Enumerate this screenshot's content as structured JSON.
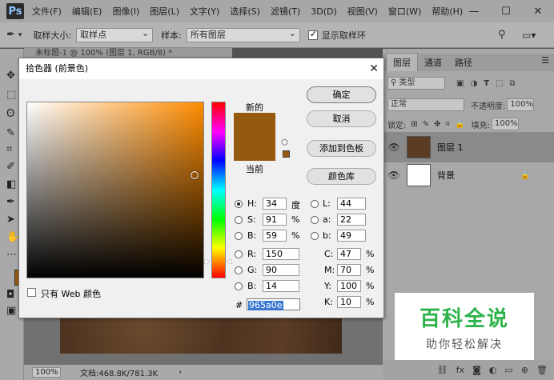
{
  "app": {
    "logo": "Ps"
  },
  "menu": [
    "文件(F)",
    "编辑(E)",
    "图像(I)",
    "图层(L)",
    "文字(Y)",
    "选择(S)",
    "滤镜(T)",
    "3D(D)",
    "视图(V)",
    "窗口(W)",
    "帮助(H)"
  ],
  "window_controls": {
    "minimize": "—",
    "maximize": "☐",
    "close": "✕"
  },
  "options": {
    "sample_size_label": "取样大小:",
    "sample_size_value": "取样点",
    "sample_label": "样本:",
    "sample_value": "所有图层",
    "show_ring_label": "显示取样环"
  },
  "document": {
    "tab_title": "未标题-1 @ 100% (图层 1, RGB/8) *",
    "zoom": "100%",
    "doc_info": "文档:468.8K/781.3K"
  },
  "panel": {
    "tabs": [
      "图层",
      "通道",
      "路径"
    ],
    "filter_kind": "类型",
    "blend_mode": "正常",
    "opacity_label": "不透明度:",
    "opacity_value": "100%",
    "lock_label": "锁定:",
    "fill_label": "填充:",
    "fill_value": "100%",
    "layers": [
      {
        "name": "图层 1",
        "selected": true
      },
      {
        "name": "背景",
        "selected": false
      }
    ]
  },
  "dialog": {
    "title": "拾色器 (前景色)",
    "new_label": "新的",
    "current_label": "当前",
    "buttons": {
      "ok": "确定",
      "cancel": "取消",
      "add_swatch": "添加到色板",
      "libraries": "颜色库"
    },
    "web_only_label": "只有 Web 颜色",
    "hsb": {
      "h_label": "H:",
      "h_value": "34",
      "h_unit": "度",
      "s_label": "S:",
      "s_value": "91",
      "s_unit": "%",
      "b_label": "B:",
      "b_value": "59",
      "b_unit": "%"
    },
    "rgb": {
      "r_label": "R:",
      "r_value": "150",
      "g_label": "G:",
      "g_value": "90",
      "b_label": "B:",
      "b_value": "14"
    },
    "lab": {
      "l_label": "L:",
      "l_value": "44",
      "a_label": "a:",
      "a_value": "22",
      "b_label": "b:",
      "b_value": "49"
    },
    "cmyk": {
      "c_label": "C:",
      "c_value": "47",
      "c_unit": "%",
      "m_label": "M:",
      "m_value": "70",
      "m_unit": "%",
      "y_label": "Y:",
      "y_value": "100",
      "y_unit": "%",
      "k_label": "K:",
      "k_value": "10",
      "k_unit": "%"
    },
    "hex_label": "#",
    "hex_value": "965a0e",
    "color_hex": "#965a0e"
  },
  "watermark": {
    "title": "百科全说",
    "subtitle": "助你轻松解决"
  }
}
